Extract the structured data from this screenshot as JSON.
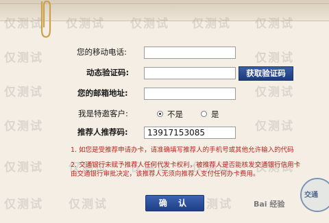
{
  "form": {
    "phone_label": "您的移动电话:",
    "phone_value": "",
    "code_label": "动态验证码:",
    "code_value": "",
    "get_code_label": "获取验证码",
    "email_label": "您的邮箱地址:",
    "email_value": "",
    "vip_label": "我是特邀客户:",
    "vip_options": [
      "不是",
      "是"
    ],
    "vip_selected": "不是",
    "referrer_label": "推荐人推荐码:",
    "referrer_value": "13917153085"
  },
  "notes": {
    "line1": "1. 如您是受推荐申请办卡，请准确填写推荐人的手机号或其他允许输入的代码",
    "line2a": "2. 交通银行未赋予推荐人任何代发卡权利，被推荐人是否能核发交通银行信用卡",
    "line2b": "由交通银行审批决定，该推荐人无须向推荐人支付任何办卡费用。"
  },
  "confirm_label": "确 认",
  "watermark_text": "仅测试",
  "logo_text": "Bai 经验",
  "stamp_text": "交通"
}
